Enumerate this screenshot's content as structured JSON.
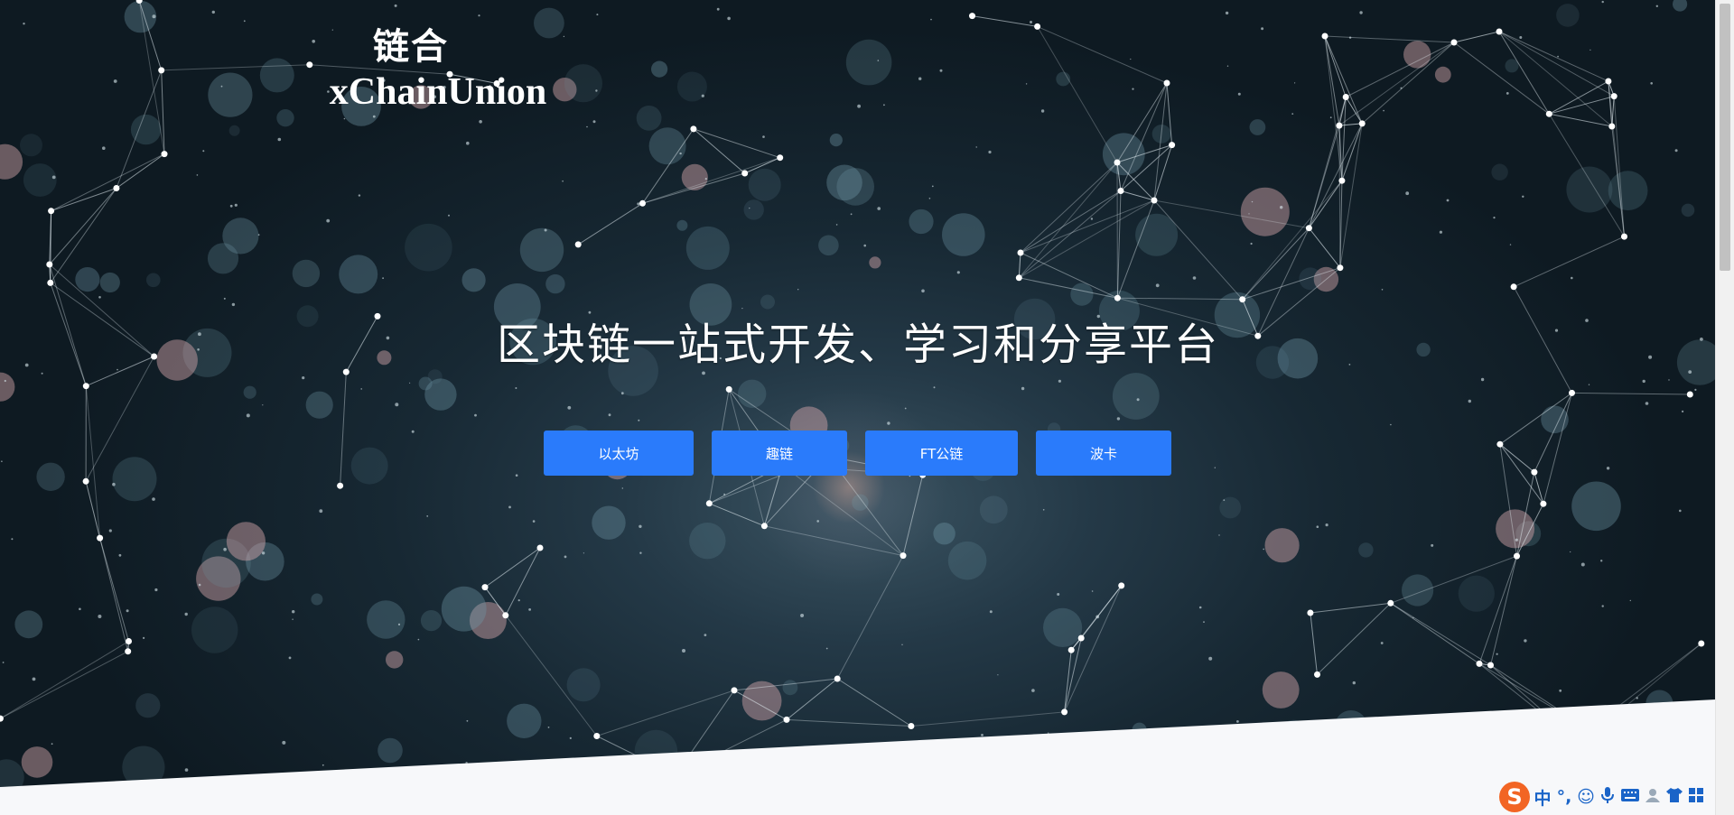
{
  "logo": {
    "chinese": "链合",
    "english": "xChainUnion"
  },
  "hero": {
    "headline": "区块链一站式开发、学习和分享平台"
  },
  "buttons": [
    {
      "label": "以太坊"
    },
    {
      "label": "趣链"
    },
    {
      "label": "FT公链"
    },
    {
      "label": "波卡"
    }
  ],
  "ime_toolbar": {
    "logo": "S",
    "mode": "中",
    "punct": "°,",
    "icons": [
      "emoji-icon",
      "microphone-icon",
      "keyboard-icon",
      "user-icon",
      "shirt-icon",
      "grid-icon"
    ]
  },
  "colors": {
    "button": "#2a7bfb",
    "ime_brand": "#f26524",
    "ime_icons": "#1a64c8"
  }
}
